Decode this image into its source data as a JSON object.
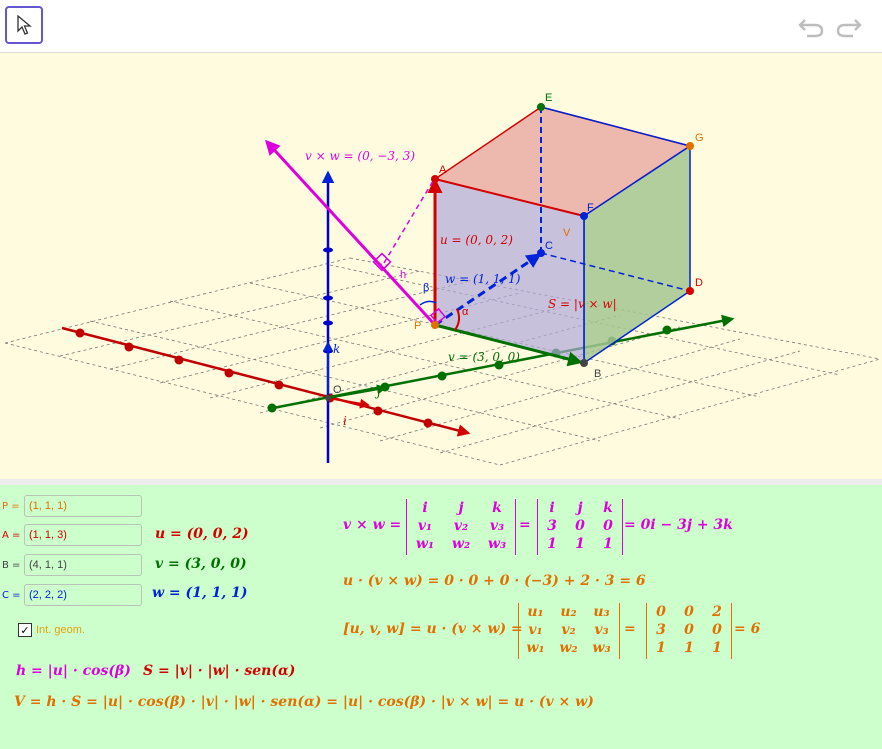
{
  "toolbar": {
    "tool_icon": "arrow-cursor-icon",
    "undo_icon": "undo-icon",
    "redo_icon": "redo-icon"
  },
  "colors": {
    "u": "#d40000",
    "v": "#007000",
    "w": "#0022d8",
    "cross": "#dd00dd",
    "orange": "#e07000",
    "graphics_bg": "#fffbdf",
    "algebra_bg": "#ccffcc",
    "x_axis": "#c00000",
    "y_axis": "#007000",
    "z_axis": "#0000d0"
  },
  "graphics": {
    "labels": {
      "O": "O",
      "P": "P",
      "A": "A",
      "B": "B",
      "C": "C",
      "D": "D",
      "E": "E",
      "F": "F",
      "G": "G",
      "V": "V",
      "h": "h",
      "alpha": "α",
      "beta": "β",
      "i": "i",
      "j": "j",
      "k": "k",
      "u_eq": "u = (0, 0, 2)",
      "v_eq": "v = (3, 0, 0)",
      "w_eq": "w = (1, 1, 1)",
      "cross_eq": "v × w = (0, −3, 3)",
      "S_eq": "S = |v × w|"
    }
  },
  "algebra": {
    "inputs": [
      {
        "label": "P =",
        "value": "(1, 1, 1)",
        "color": "#e07000"
      },
      {
        "label": "A =",
        "value": "(1, 1, 3)",
        "color": "#d40000"
      },
      {
        "label": "B =",
        "value": "(4, 1, 1)",
        "color": "#444444"
      },
      {
        "label": "C =",
        "value": "(2, 2, 2)",
        "color": "#0022d8"
      }
    ],
    "vectors": {
      "u": "u = (0, 0, 2)",
      "v": "v = (3, 0, 0)",
      "w": "w = (1, 1, 1)"
    },
    "checkbox": {
      "label": "Int. geom.",
      "checked": true
    },
    "formulas": {
      "cross_lhs": "v × w =",
      "cross_det": [
        [
          "i",
          "j",
          "k"
        ],
        [
          "v₁",
          "v₂",
          "v₃"
        ],
        [
          "w₁",
          "w₂",
          "w₃"
        ]
      ],
      "cross_num": [
        [
          "i",
          "j",
          "k"
        ],
        [
          "3",
          "0",
          "0"
        ],
        [
          "1",
          "1",
          "1"
        ]
      ],
      "cross_result": "= 0i − 3j + 3k",
      "dot_line": "u · (v × w) = 0 · 0 + 0 · (−3) + 2 · 3 = 6",
      "triple_lhs": "[u, v, w] = u · (v × w) =",
      "triple_det": [
        [
          "u₁",
          "u₂",
          "u₃"
        ],
        [
          "v₁",
          "v₂",
          "v₃"
        ],
        [
          "w₁",
          "w₂",
          "w₃"
        ]
      ],
      "triple_num": [
        [
          "0",
          "0",
          "2"
        ],
        [
          "3",
          "0",
          "0"
        ],
        [
          "1",
          "1",
          "1"
        ]
      ],
      "triple_result": "= 6",
      "h_formula": "h = |u| · cos(β)",
      "S_formula": "S = |v| · |w| · sen(α)",
      "V_formula": "V = h · S = |u| · cos(β) · |v| · |w| · sen(α) = |u| · cos(β) · |v × w| = u · (v × w)"
    }
  }
}
